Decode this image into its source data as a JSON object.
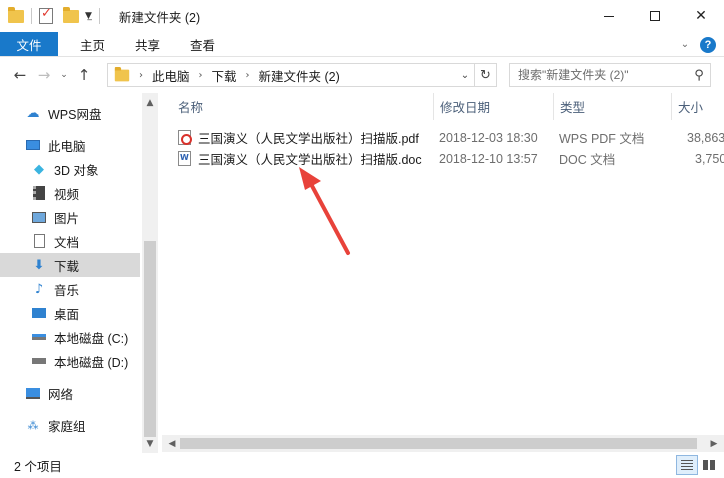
{
  "window": {
    "title": "新建文件夹 (2)",
    "controls": {
      "minimize_icon": "minimize-icon",
      "maximize_icon": "maximize-icon",
      "close_icon": "close-icon"
    }
  },
  "quick_access": {
    "icons": [
      "folder-icon",
      "properties-check-icon",
      "new-folder-icon",
      "dropdown-icon"
    ]
  },
  "ribbon": {
    "file_tab": "文件",
    "tabs": [
      "主页",
      "共享",
      "查看"
    ],
    "accent_color": "#1979ca"
  },
  "navigation": {
    "path": [
      "此电脑",
      "下载",
      "新建文件夹 (2)"
    ],
    "search_placeholder": "搜索\"新建文件夹 (2)\""
  },
  "sidebar": {
    "items": [
      {
        "label": "WPS网盘",
        "icon": "cloud-icon"
      },
      {
        "label": "此电脑",
        "icon": "computer-icon"
      },
      {
        "label": "3D 对象",
        "icon": "cube-icon"
      },
      {
        "label": "视频",
        "icon": "video-icon"
      },
      {
        "label": "图片",
        "icon": "picture-icon"
      },
      {
        "label": "文档",
        "icon": "document-icon"
      },
      {
        "label": "下载",
        "icon": "download-icon",
        "selected": true
      },
      {
        "label": "音乐",
        "icon": "music-icon"
      },
      {
        "label": "桌面",
        "icon": "desktop-icon"
      },
      {
        "label": "本地磁盘 (C:)",
        "icon": "drive-c-icon"
      },
      {
        "label": "本地磁盘 (D:)",
        "icon": "drive-d-icon"
      },
      {
        "label": "网络",
        "icon": "network-icon"
      },
      {
        "label": "家庭组",
        "icon": "homegroup-icon"
      }
    ]
  },
  "file_list": {
    "columns": [
      "名称",
      "修改日期",
      "类型",
      "大小"
    ],
    "rows": [
      {
        "name": "三国演义（人民文学出版社）扫描版.pdf",
        "modified": "2018-12-03 18:30",
        "type": "WPS PDF 文档",
        "size": "38,863",
        "icon": "pdf-file-icon"
      },
      {
        "name": "三国演义（人民文学出版社）扫描版.doc",
        "modified": "2018-12-10 13:57",
        "type": "DOC 文档",
        "size": "3,750",
        "icon": "doc-file-icon"
      }
    ]
  },
  "status": {
    "item_count": "2 个项目"
  },
  "annotation": {
    "color": "#e8423a"
  }
}
